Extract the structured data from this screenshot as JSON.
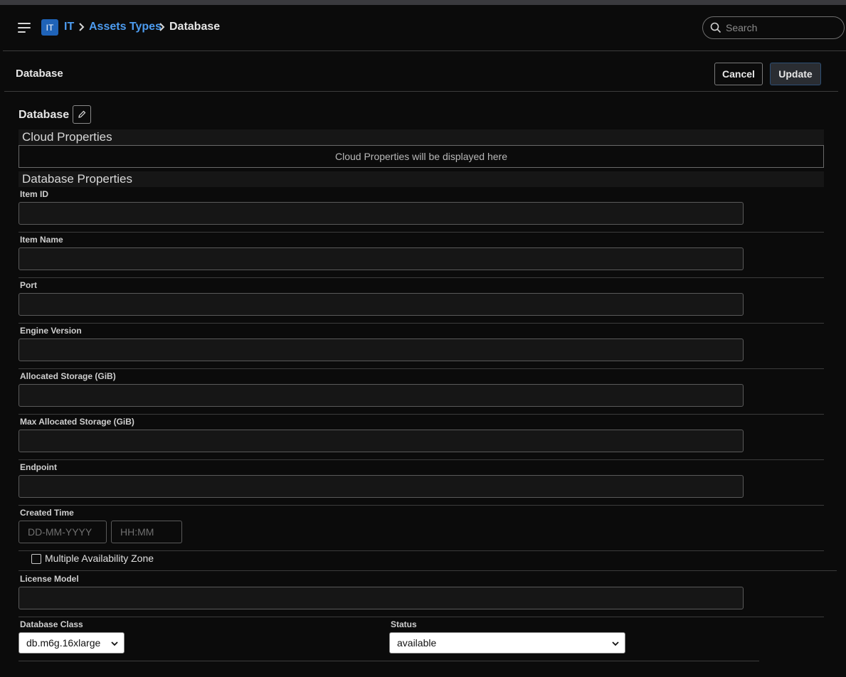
{
  "header": {
    "app_badge": "IT",
    "breadcrumb": [
      "IT",
      "Assets Types",
      "Database"
    ],
    "search_placeholder": "Search"
  },
  "page": {
    "title": "Database",
    "cancel_label": "Cancel",
    "update_label": "Update"
  },
  "entity": {
    "title": "Database"
  },
  "sections": {
    "cloud": {
      "title": "Cloud Properties",
      "placeholder_text": "Cloud Properties will be displayed here"
    },
    "database": {
      "title": "Database Properties"
    }
  },
  "fields": [
    {
      "label": "Item ID",
      "value": ""
    },
    {
      "label": "Item Name",
      "value": ""
    },
    {
      "label": "Port",
      "value": ""
    },
    {
      "label": "Engine Version",
      "value": ""
    },
    {
      "label": "Allocated Storage (GiB)",
      "value": ""
    },
    {
      "label": "Max Allocated Storage (GiB)",
      "value": ""
    },
    {
      "label": "Endpoint",
      "value": ""
    }
  ],
  "created_time": {
    "label": "Created Time",
    "date_placeholder": "DD-MM-YYYY",
    "time_placeholder": "HH:MM"
  },
  "multi_az": {
    "label": "Multiple Availability Zone",
    "checked": false
  },
  "license_model": {
    "label": "License Model",
    "value": ""
  },
  "database_class": {
    "label": "Database Class",
    "selected": "db.m6g.16xlarge"
  },
  "status": {
    "label": "Status",
    "selected": "available"
  },
  "colors": {
    "background": "#0b0b0b",
    "link": "#4d9cf0",
    "badge": "#1f63b8"
  }
}
